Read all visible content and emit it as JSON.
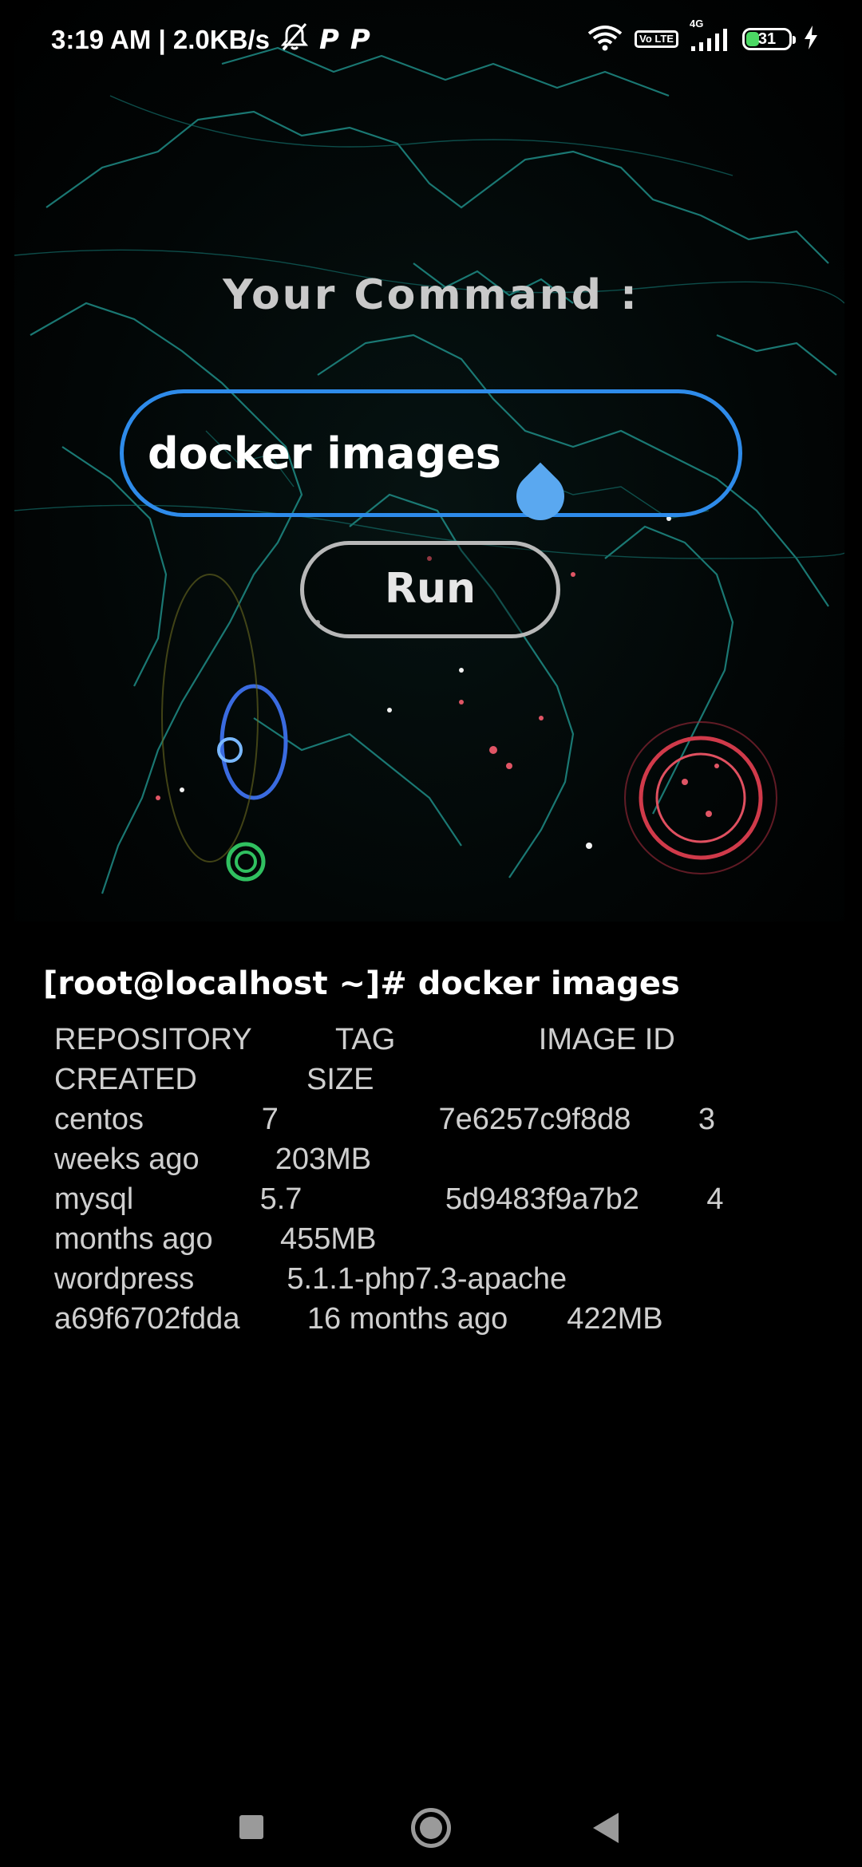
{
  "status_bar": {
    "time_speed": "3:19 AM | 2.0KB/s",
    "p_icon_1": "P",
    "p_icon_2": "P",
    "volte": "Vo LTE",
    "network": "4G",
    "battery_level": "31",
    "icons": [
      "bell-off-icon",
      "wifi-icon",
      "signal-icon",
      "charging-icon"
    ]
  },
  "command": {
    "label": "Your Command :",
    "input_value": "docker images",
    "run_label": "Run",
    "accent_color": "#2e8bea"
  },
  "output": {
    "prompt": "[root@localhost ~]# docker images",
    "lines": [
      "REPOSITORY          TAG                 IMAGE ID",
      "CREATED             SIZE",
      "centos              7                   7e6257c9f8d8        3",
      "weeks ago         203MB",
      "mysql               5.7                 5d9483f9a7b2        4",
      "months ago        455MB",
      "wordpress           5.1.1-php7.3-apache",
      "a69f6702fdda        16 months ago       422MB"
    ]
  },
  "nav": {
    "icons": [
      "recents-square-icon",
      "home-circle-icon",
      "back-triangle-icon"
    ]
  }
}
